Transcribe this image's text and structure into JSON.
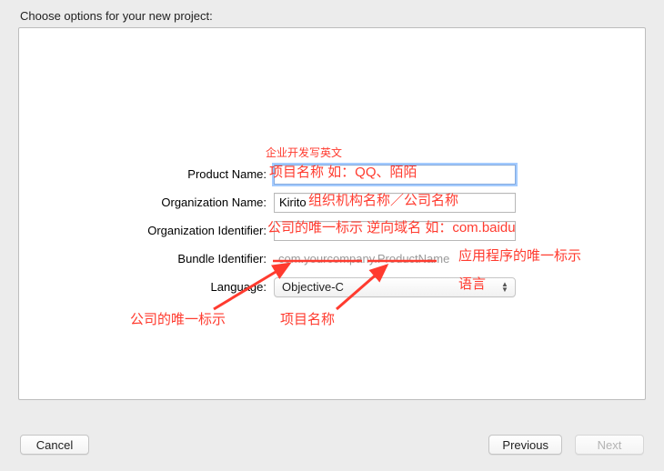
{
  "heading": "Choose options for your new project:",
  "form": {
    "product_name": {
      "label": "Product Name:",
      "value": ""
    },
    "org_name": {
      "label": "Organization Name:",
      "value": "Kirito"
    },
    "org_id": {
      "label": "Organization Identifier:",
      "value": ""
    },
    "bundle_id": {
      "label": "Bundle Identifier:",
      "value": "com.yourcompany.ProductName"
    },
    "language": {
      "label": "Language:",
      "value": "Objective-C"
    }
  },
  "buttons": {
    "cancel": "Cancel",
    "previous": "Previous",
    "next": "Next"
  },
  "annotations": {
    "a1": "企业开发写英文",
    "a2": "项目名称 如：QQ、陌陌",
    "a3": "组织机构名称／公司名称",
    "a4": "公司的唯一标示  逆向域名 如：com.baidu",
    "a5": "应用程序的唯一标示",
    "a6": "语言",
    "a7": "公司的唯一标示",
    "a8": "项目名称"
  }
}
